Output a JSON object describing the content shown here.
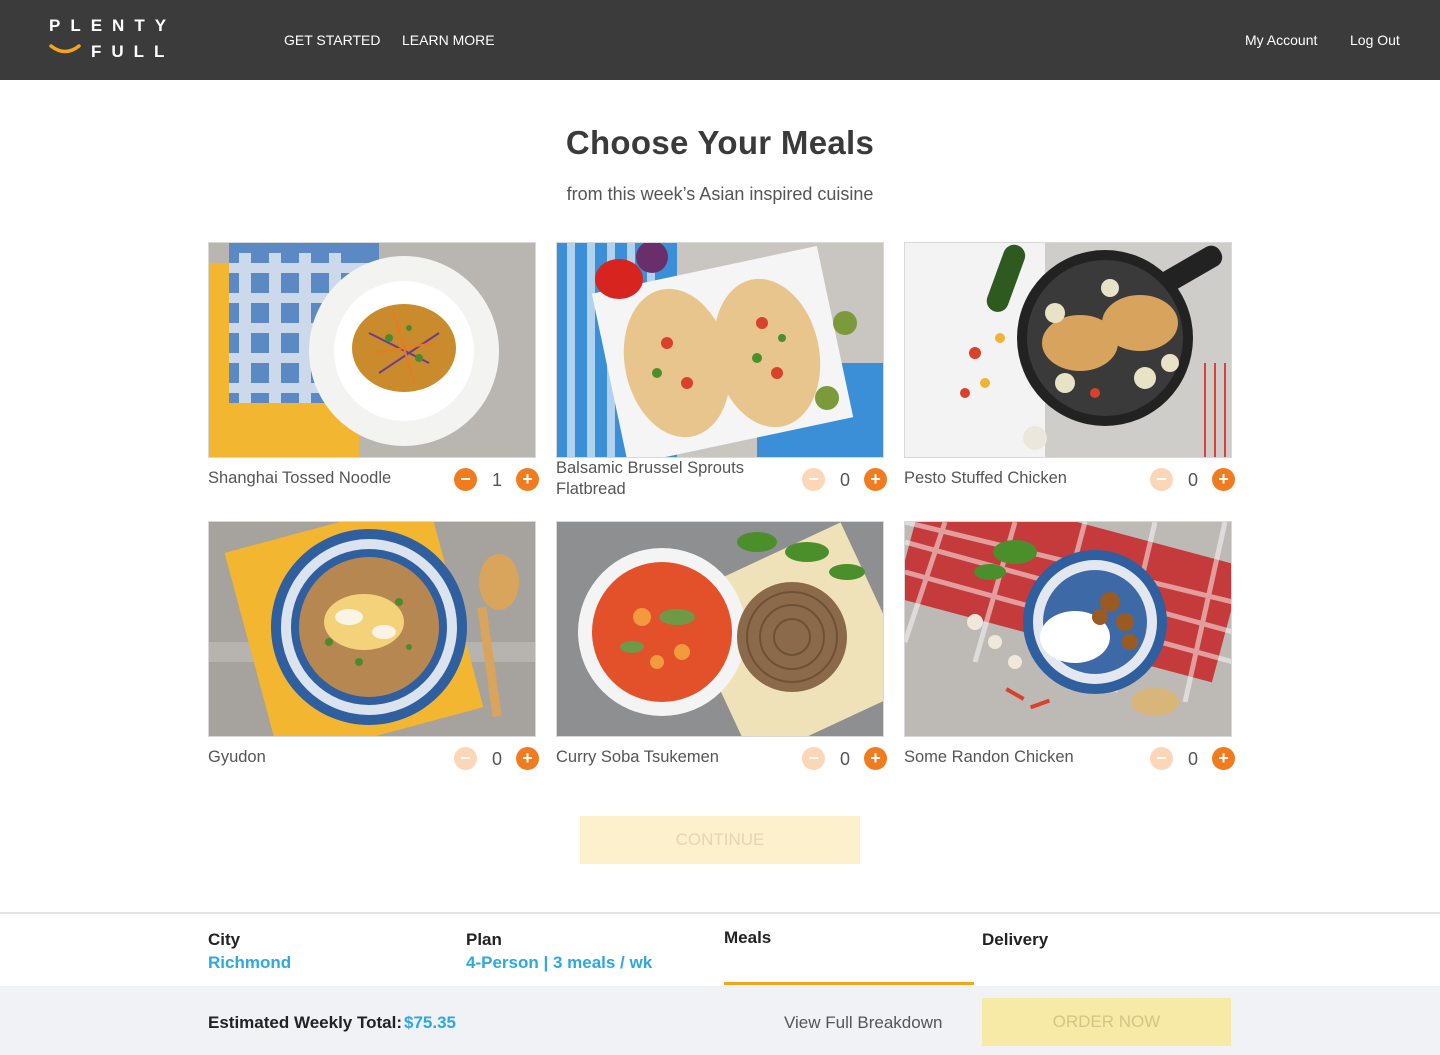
{
  "brand": {
    "line1": "PLENTY",
    "line2": "FULL",
    "accent": "#f4a51c"
  },
  "nav": {
    "left": [
      "GET STARTED",
      "LEARN MORE"
    ],
    "right": [
      "My Account",
      "Log Out"
    ]
  },
  "page": {
    "title": "Choose Your Meals",
    "subtitle": "from this week’s Asian inspired cuisine"
  },
  "meals": [
    {
      "name": "Shanghai Tossed Noodle",
      "qty": "1",
      "minus_enabled": true
    },
    {
      "name": "Balsamic Brussel Sprouts Flatbread",
      "qty": "0",
      "minus_enabled": false
    },
    {
      "name": "Pesto Stuffed Chicken",
      "qty": "0",
      "minus_enabled": false
    },
    {
      "name": "Gyudon",
      "qty": "0",
      "minus_enabled": false
    },
    {
      "name": "Curry Soba Tsukemen",
      "qty": "0",
      "minus_enabled": false
    },
    {
      "name": "Some Randon Chicken",
      "qty": "0",
      "minus_enabled": false
    }
  ],
  "continue_label": "CONTINUE",
  "steps": [
    {
      "label": "City",
      "value": "Richmond"
    },
    {
      "label": "Plan",
      "value": "4-Person | 3 meals / wk"
    },
    {
      "label": "Meals",
      "value": ""
    },
    {
      "label": "Delivery",
      "value": ""
    }
  ],
  "summary": {
    "total_label": "Estimated Weekly Total:",
    "total_value": "$75.35",
    "breakdown_label": "View Full Breakdown",
    "order_label": "ORDER NOW"
  },
  "colors": {
    "header_bg": "#3b3b3b",
    "accent_orange": "#f07c1f",
    "link_blue": "#2fa7e0",
    "active_step": "#f4a51c"
  }
}
